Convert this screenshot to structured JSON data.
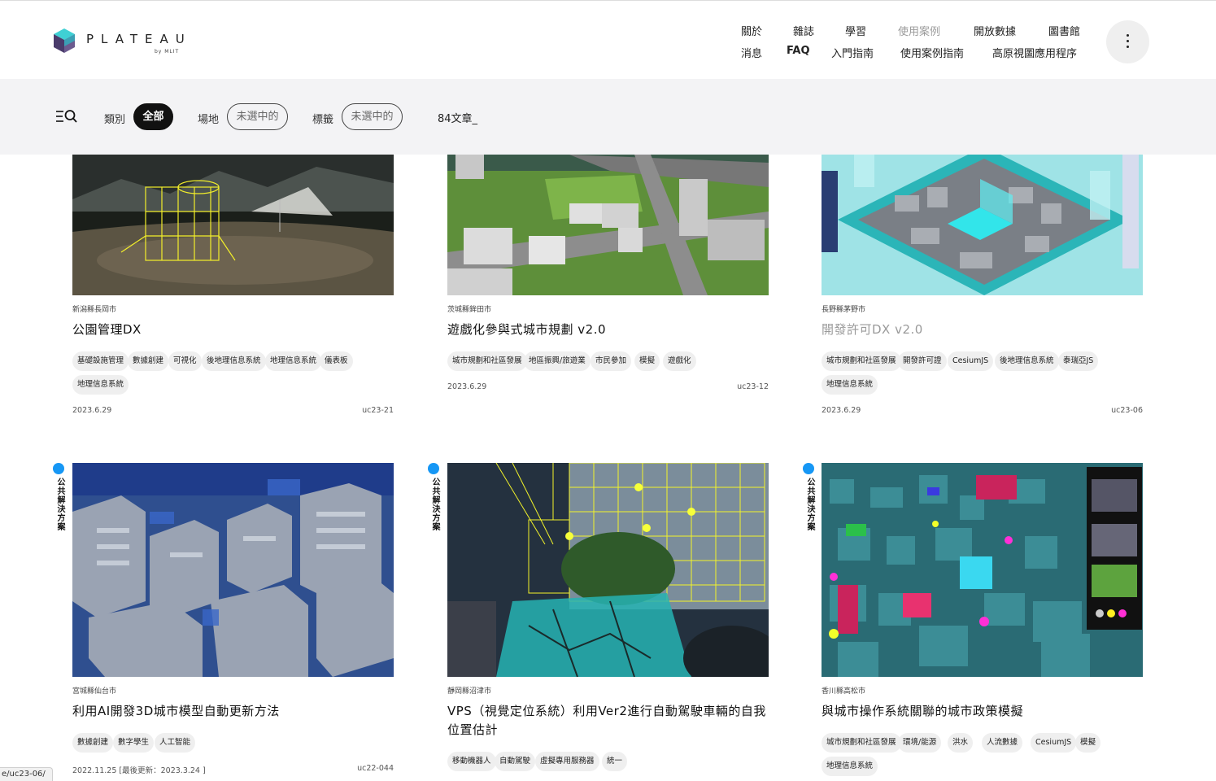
{
  "header": {
    "logo_word": "PLATEAU",
    "logo_sub": "by MLIT",
    "nav_top": [
      "關於",
      "雜誌",
      "學習",
      "使用案例",
      "開放數據",
      "圖書館"
    ],
    "nav_bottom": [
      "消息",
      "FAQ",
      "入門指南",
      "使用案例指南",
      "高原視圖應用程序"
    ]
  },
  "filter": {
    "category_label": "類別",
    "category_value": "全部",
    "place_label": "場地",
    "place_value": "未選中的",
    "tag_label": "標籤",
    "tag_value": "未選中的",
    "count": "84文章_"
  },
  "cards": [
    {
      "location": "新潟縣長岡市",
      "title": "公園管理DX",
      "tags": [
        "基礎設施管理",
        "數據創建",
        "可視化",
        "後地理信息系統",
        "地理信息系統",
        "儀表板",
        "地理信息系統"
      ],
      "date": "2023.6.29",
      "id": "uc23-21"
    },
    {
      "location": "茨城縣鉾田市",
      "title": "遊戲化參與式城市規劃 v2.0",
      "tags": [
        "城市規劃和社區發展",
        "地區振興/旅遊業",
        "市民參加",
        "模擬",
        "遊戲化"
      ],
      "date": "2023.6.29",
      "id": "uc23-12"
    },
    {
      "location": "長野縣茅野市",
      "title": "開發許可DX v2.0",
      "tags": [
        "城市規劃和社區發展",
        "開發許可證",
        "CesiumJS",
        "後地理信息系統",
        "泰瑞亞JS",
        "地理信息系統"
      ],
      "date": "2023.6.29",
      "id": "uc23-06"
    },
    {
      "badge": "公共解決方案",
      "location": "宮城縣仙台市",
      "title": "利用AI開發3D城市模型自動更新方法",
      "tags": [
        "數據創建",
        "數字學生",
        "人工智能"
      ],
      "date": "2022.11.25 [最後更新：2023.3.24 ]",
      "id": "uc22-044"
    },
    {
      "badge": "公共解決方案",
      "location": "靜岡縣沼津市",
      "title": "VPS（視覺定位系統）利用Ver2進行自動駕駛車輛的自我位置估計",
      "tags": [
        "移動機器人",
        "自動駕駛",
        "虛擬專用服務器",
        "統一"
      ],
      "date": "",
      "id": ""
    },
    {
      "badge": "公共解決方案",
      "location": "香川縣高松市",
      "title": "與城市操作系統關聯的城市政策模擬",
      "tags": [
        "城市規劃和社區發展",
        "環境/能源",
        "洪水",
        "人流數據",
        "CesiumJS",
        "模擬",
        "地理信息系統"
      ],
      "date": "",
      "id": ""
    }
  ],
  "status_url": "e/uc23-06/"
}
